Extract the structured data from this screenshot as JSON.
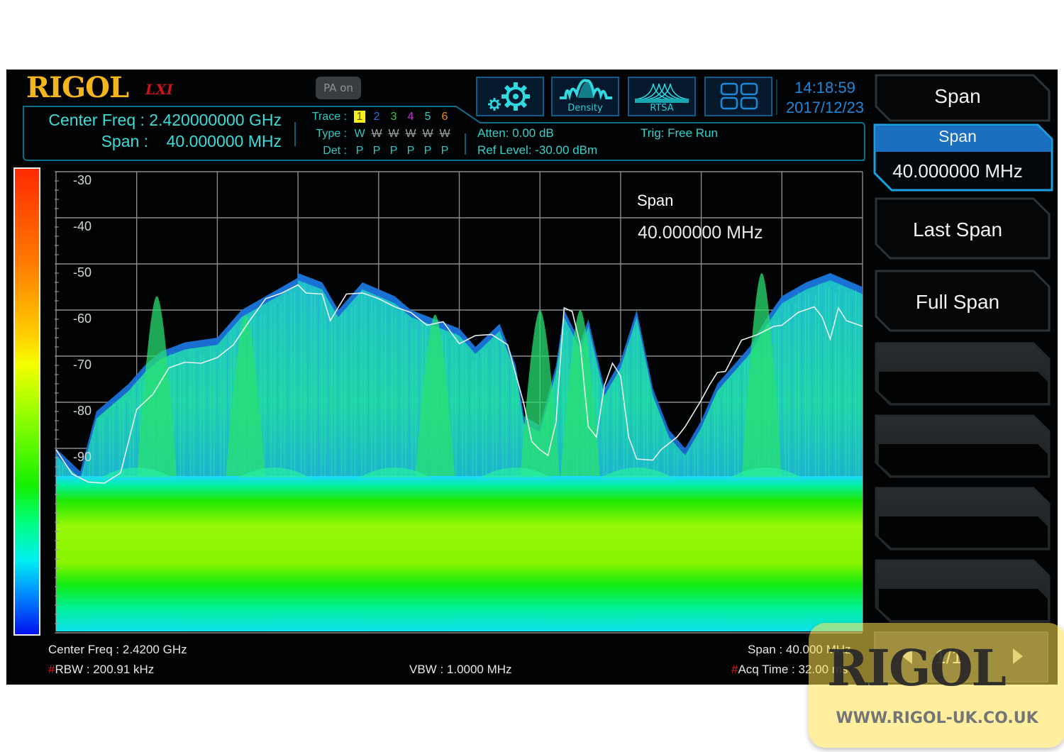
{
  "header": {
    "brand": "RIGOL",
    "brand_suffix": "LXI",
    "pa_badge": "PA on",
    "center_freq_label": "Center Freq : 2.420000000 GHz",
    "span_label": "Span :    40.000000 MHz",
    "trace": {
      "trace_label": "Trace :",
      "type_label": "Type :",
      "det_label": "Det :",
      "traces": [
        {
          "num": "1",
          "type": "W",
          "det": "P",
          "color": "#f5ee1a",
          "active": true
        },
        {
          "num": "2",
          "type": "W",
          "det": "P",
          "color": "#2f6fd8",
          "active": false
        },
        {
          "num": "3",
          "type": "W",
          "det": "P",
          "color": "#2fc84a",
          "active": false
        },
        {
          "num": "4",
          "type": "W",
          "det": "P",
          "color": "#c830d8",
          "active": false
        },
        {
          "num": "5",
          "type": "W",
          "det": "P",
          "color": "#2fc8c4",
          "active": false
        },
        {
          "num": "6",
          "type": "W",
          "det": "P",
          "color": "#e88a1a",
          "active": false
        }
      ]
    },
    "toolbar": [
      {
        "name": "settings",
        "icon": "gears-icon",
        "caption": ""
      },
      {
        "name": "density",
        "icon": "density-icon",
        "caption": "Density"
      },
      {
        "name": "rtsa",
        "icon": "rtsa-icon",
        "caption": "RTSA"
      },
      {
        "name": "layout",
        "icon": "grid-layout-icon",
        "caption": ""
      }
    ],
    "time": "14:18:59",
    "date": "2017/12/23",
    "atten": "Atten: 0.00 dB",
    "ref_level": "Ref Level: -30.00 dBm",
    "trig": "Trig: Free Run"
  },
  "softkeys": {
    "title": "Span",
    "items": [
      {
        "label": "Span",
        "value": "40.000000 MHz",
        "selected": true
      },
      {
        "label": "Last Span"
      },
      {
        "label": "Full Span"
      },
      {
        "label": ""
      },
      {
        "label": ""
      },
      {
        "label": ""
      },
      {
        "label": ""
      }
    ],
    "page_indicator": "1/1"
  },
  "plot": {
    "overlay_label": "Span",
    "overlay_value": "40.000000 MHz",
    "y_ticks": [
      "-30",
      "-40",
      "-50",
      "-60",
      "-70",
      "-80",
      "-90"
    ],
    "y_range_dbm": [
      -30,
      -130
    ],
    "x_divisions": 10,
    "colorbar": [
      "#ff2a00",
      "#ffd000",
      "#f4ff00",
      "#14f000",
      "#00f0f0",
      "#0010f0"
    ],
    "trace_color": "#e8f0f0"
  },
  "footer": {
    "center_freq": "Center Freq : 2.4200 GHz",
    "rbw_prefix": "#",
    "rbw": "RBW : 200.91 kHz",
    "vbw": "VBW : 1.0000 MHz",
    "span": "Span : 40.000 MHz",
    "acq_prefix": "#",
    "acq_time": "Acq Time : 32.00 ms"
  },
  "watermark": {
    "logo": "RIGOL",
    "url": "WWW.RIGOL-UK.CO.UK"
  }
}
